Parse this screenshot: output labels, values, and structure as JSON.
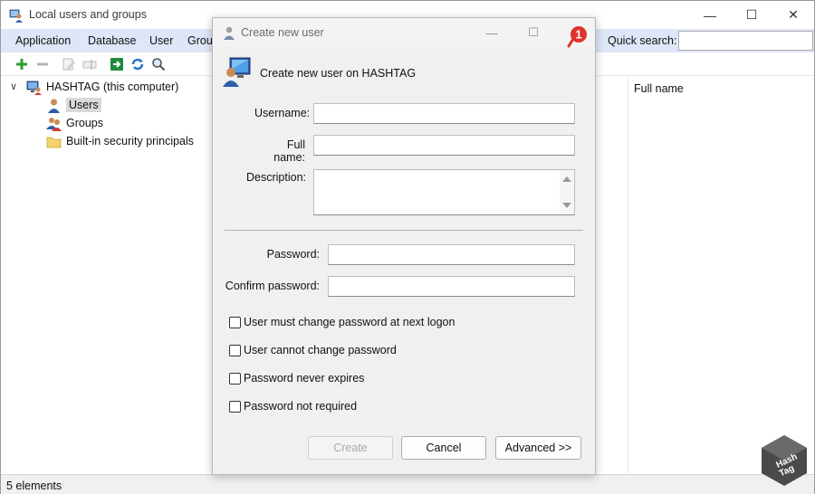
{
  "window": {
    "title": "Local users and groups",
    "minimize_glyph": "—",
    "maximize_glyph": "☐",
    "close_glyph": "✕"
  },
  "menu": {
    "items": [
      "Application",
      "Database",
      "User",
      "Group"
    ]
  },
  "quick_search": {
    "label": "Quick search:",
    "value": ""
  },
  "toolbar": {
    "icons": [
      "add-icon",
      "remove-icon",
      "edit-icon",
      "rename-icon",
      "go-icon",
      "refresh-icon",
      "search-icon"
    ]
  },
  "tree": {
    "root": {
      "label": "HASHTAG (this computer)",
      "icon": "computer-icon"
    },
    "children": [
      {
        "label": "Users",
        "icon": "user-icon",
        "selected": true
      },
      {
        "label": "Groups",
        "icon": "group-icon",
        "selected": false
      },
      {
        "label": "Built-in security principals",
        "icon": "folder-icon",
        "selected": false
      }
    ]
  },
  "list": {
    "column_header": "Full name"
  },
  "status": {
    "text": "5 elements"
  },
  "dialog": {
    "title": "Create new user",
    "header": "Create new user on HASHTAG",
    "badge_number": "1",
    "fields": {
      "username_label": "Username:",
      "username_value": "",
      "fullname_label": "Full name:",
      "fullname_value": "",
      "description_label": "Description:",
      "description_value": "",
      "password_label": "Password:",
      "password_value": "",
      "confirm_label": "Confirm password:",
      "confirm_value": ""
    },
    "checkboxes": [
      {
        "label": "User must change password at next logon",
        "checked": false
      },
      {
        "label": "User cannot change password",
        "checked": false
      },
      {
        "label": "Password never expires",
        "checked": false
      },
      {
        "label": "Password not required",
        "checked": false
      }
    ],
    "buttons": {
      "create": "Create",
      "cancel": "Cancel",
      "advanced": "Advanced >>"
    }
  },
  "watermark": {
    "line1": "Hash",
    "line2": "Tag"
  },
  "colors": {
    "menubar_bg": "#dfe6f7",
    "badge_red": "#e0332b",
    "dialog_bg": "#f0f0f0"
  }
}
